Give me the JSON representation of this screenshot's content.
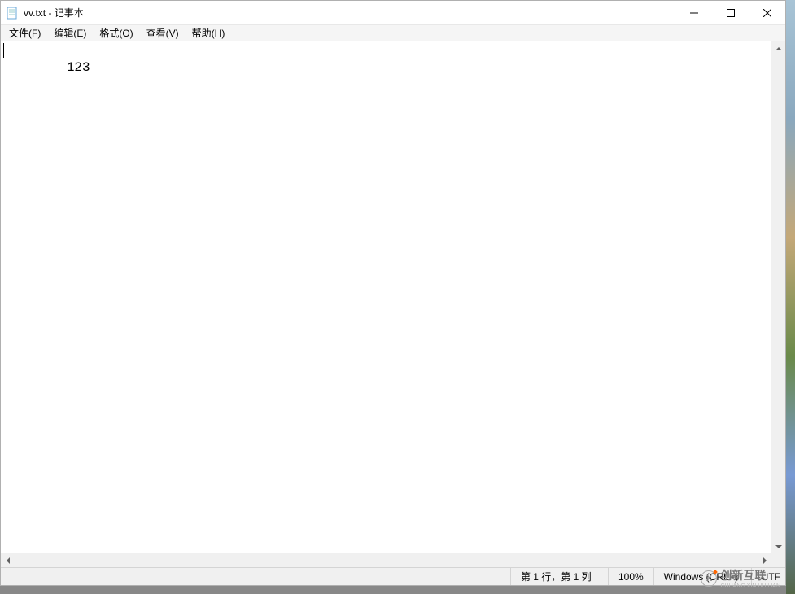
{
  "window": {
    "title": "vv.txt - 记事本"
  },
  "menubar": {
    "file": "文件(F)",
    "edit": "编辑(E)",
    "format": "格式(O)",
    "view": "查看(V)",
    "help": "帮助(H)"
  },
  "editor": {
    "content": "123"
  },
  "statusbar": {
    "position": "第 1 行，第 1 列",
    "zoom": "100%",
    "line_ending": "Windows (CRLF)",
    "encoding": "UTF"
  },
  "watermark": {
    "icon_letter": "X",
    "main": "创新互联",
    "sub": "CHUANG XIN HU LIAN"
  }
}
